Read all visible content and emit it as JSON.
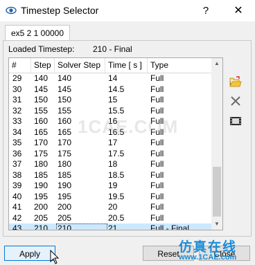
{
  "window": {
    "title": "Timestep Selector",
    "help_label": "?",
    "close_label": "✕"
  },
  "tab": {
    "label": "ex5 2 1 00000"
  },
  "loaded": {
    "label": "Loaded Timestep:",
    "value": "210 - Final"
  },
  "table": {
    "columns": [
      "#",
      "Step",
      "Solver Step",
      "Time [ s ]",
      "Type"
    ],
    "rows": [
      [
        "29",
        "140",
        "140",
        "14",
        "Full"
      ],
      [
        "30",
        "145",
        "145",
        "14.5",
        "Full"
      ],
      [
        "31",
        "150",
        "150",
        "15",
        "Full"
      ],
      [
        "32",
        "155",
        "155",
        "15.5",
        "Full"
      ],
      [
        "33",
        "160",
        "160",
        "16",
        "Full"
      ],
      [
        "34",
        "165",
        "165",
        "16.5",
        "Full"
      ],
      [
        "35",
        "170",
        "170",
        "17",
        "Full"
      ],
      [
        "36",
        "175",
        "175",
        "17.5",
        "Full"
      ],
      [
        "37",
        "180",
        "180",
        "18",
        "Full"
      ],
      [
        "38",
        "185",
        "185",
        "18.5",
        "Full"
      ],
      [
        "39",
        "190",
        "190",
        "19",
        "Full"
      ],
      [
        "40",
        "195",
        "195",
        "19.5",
        "Full"
      ],
      [
        "41",
        "200",
        "200",
        "20",
        "Full"
      ],
      [
        "42",
        "205",
        "205",
        "20.5",
        "Full"
      ],
      [
        "43",
        "210",
        "210",
        "21",
        "Full - Final"
      ]
    ],
    "selected_index": 14
  },
  "side_tools": [
    "open-folder-icon",
    "delete-x-icon",
    "film-strip-icon"
  ],
  "buttons": {
    "apply": "Apply",
    "reset": "Reset",
    "close": "Close"
  },
  "watermark": {
    "main": "1CAE.COM",
    "cn": "仿真在线",
    "url": "www.1CAE.com"
  },
  "colors": {
    "selection": "#cce8ff",
    "accent": "#0078d7",
    "watermark": "#1a8cd8"
  }
}
